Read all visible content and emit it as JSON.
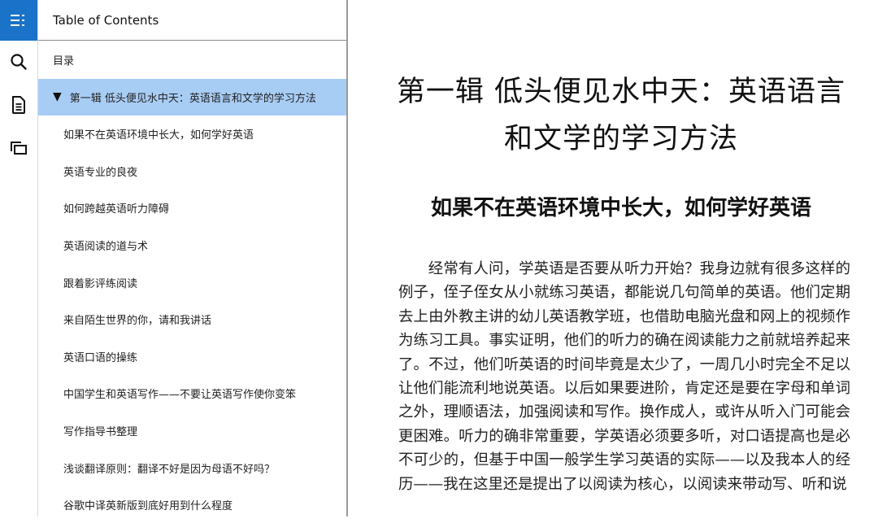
{
  "rail": {
    "items": [
      {
        "name": "table-of-contents",
        "icon": "toc-list-icon",
        "active": true
      },
      {
        "name": "search",
        "icon": "search-icon",
        "active": false
      },
      {
        "name": "notes",
        "icon": "document-icon",
        "active": false
      },
      {
        "name": "flashcards",
        "icon": "cards-icon",
        "active": false
      }
    ],
    "accent_color": "#1a73c8"
  },
  "toc": {
    "header": "Table of Contents",
    "selected_color": "#a8cdf5",
    "items": [
      {
        "label": "目录",
        "level": 0
      },
      {
        "label": "第一辑 低头便见水中天：英语语言和文学的学习方法",
        "level": 0,
        "expanded": true,
        "selected": true,
        "marker": "▼"
      },
      {
        "label": "如果不在英语环境中长大，如何学好英语",
        "level": 1
      },
      {
        "label": "英语专业的良夜",
        "level": 1
      },
      {
        "label": "如何跨越英语听力障碍",
        "level": 1
      },
      {
        "label": "英语阅读的道与术",
        "level": 1
      },
      {
        "label": "跟着影评练阅读",
        "level": 1
      },
      {
        "label": "来自陌生世界的你，请和我讲话",
        "level": 1
      },
      {
        "label": "英语口语的操练",
        "level": 1
      },
      {
        "label": "中国学生和英语写作——不要让英语写作使你变笨",
        "level": 1
      },
      {
        "label": "写作指导书整理",
        "level": 1
      },
      {
        "label": "浅谈翻译原则：翻译不好是因为母语不好吗？",
        "level": 1
      },
      {
        "label": "谷歌中译英新版到底好用到什么程度",
        "level": 1
      }
    ]
  },
  "reader": {
    "chapter_title": "第一辑 低头便见水中天：英语语言和文学的学习方法",
    "section_title": "如果不在英语环境中长大，如何学好英语",
    "paragraph": "经常有人问，学英语是否要从听力开始？我身边就有很多这样的例子，侄子侄女从小就练习英语，都能说几句简单的英语。他们定期去上由外教主讲的幼儿英语教学班，也借助电脑光盘和网上的视频作为练习工具。事实证明，他们的听力的确在阅读能力之前就培养起来了。不过，他们听英语的时间毕竟是太少了，一周几小时完全不足以让他们能流利地说英语。以后如果要进阶，肯定还是要在字母和单词之外，理顺语法，加强阅读和写作。换作成人，或许从听入门可能会更困难。听力的确非常重要，学英语必须要多听，对口语提高也是必不可少的，但基于中国一般学生学习英语的实际——以及我本人的经历——我在这里还是提出了以阅读为核心，以阅读来带动写、听和说"
  }
}
